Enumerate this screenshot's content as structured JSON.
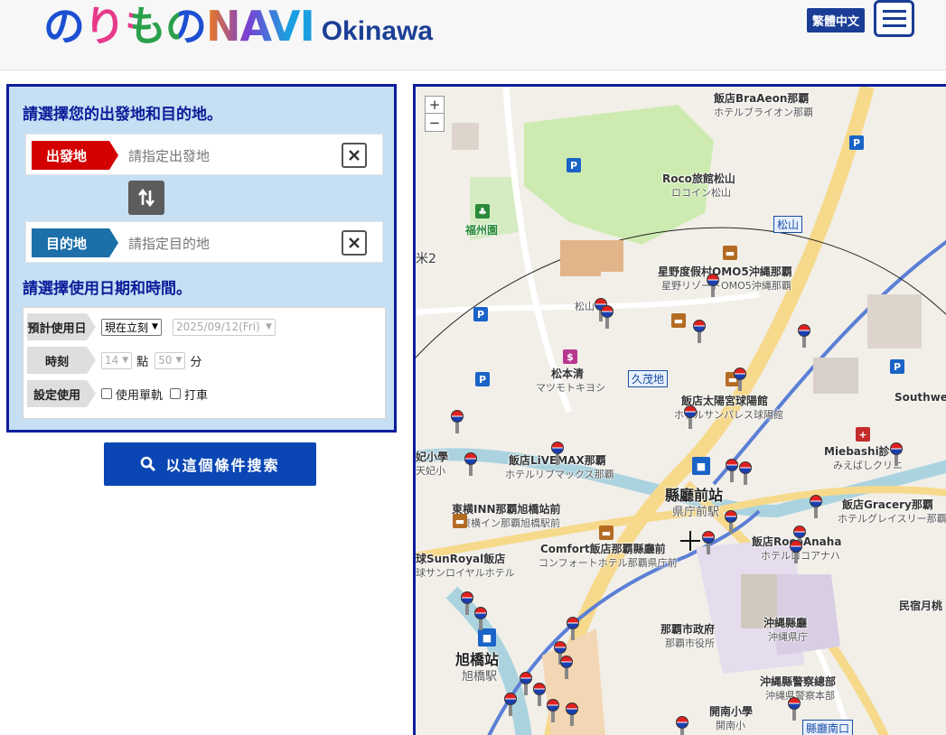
{
  "header": {
    "logo_text": "のりものNAVI",
    "logo_region": "Okinawa",
    "language_label": "繁體中文",
    "menu_icon": "hamburger-menu-icon"
  },
  "search": {
    "title": "請選擇您的出發地和目的地。",
    "origin": {
      "tag": "出發地",
      "placeholder": "請指定出發地"
    },
    "destination": {
      "tag": "目的地",
      "placeholder": "請指定目的地"
    },
    "swap_icon": "swap-arrows-icon",
    "clear_icon": "close-icon",
    "date_title": "請選擇使用日期和時間。",
    "options": {
      "date_label": "預計使用日",
      "date_mode": "現在立刻",
      "date_value": "2025/09/12(Fri)",
      "time_label": "時刻",
      "hour": "14",
      "hour_unit": "點",
      "minute": "50",
      "minute_unit": "分",
      "settings_label": "設定使用",
      "monorail_label": "使用單軌",
      "taxi_label": "打車"
    },
    "submit_label": "以這個條件搜索"
  },
  "map": {
    "zoom_in": "+",
    "zoom_out": "−",
    "labels": {
      "l1": "飯店BraAeon那覇",
      "l1s": "ホテルブライオン那覇",
      "l2": "Roco旅館松山",
      "l2s": "ロコイン松山",
      "l3": "福州園",
      "l4": "松山",
      "l5": "星野度假村OMO5沖縄那覇",
      "l5s": "星野リゾートOMO5沖縄那覇",
      "l6": "松本清",
      "l6s": "マツモトキヨシ",
      "l7": "久茂地",
      "l8": "飯店太陽宮球陽館",
      "l8s": "ホテルサンパレス球陽館",
      "l9": "Southwes",
      "l10": "飯店LiVEMAX那覇",
      "l10s": "ホテルリブマックス那覇",
      "l11": "Miebashi診",
      "l11s": "みえばしクリニ",
      "l12": "縣廳前站",
      "l12s": "県庁前駅",
      "l13": "東横INN那覇旭橋站前",
      "l13s": "東横イン那覇旭橋駅前",
      "l14": "飯店Gracery那覇",
      "l14s": "ホテルグレイスリー那覇",
      "l15": "Comfort飯店那覇縣廳前",
      "l15s": "コンフォートホテル那覇県庁前",
      "l16": "飯店RocoAnaha",
      "l16s": "ホテルロコアナハ",
      "l17": "球SunRoyal飯店",
      "l17s": "球サンロイヤルホテル",
      "l18": "那覇市政府",
      "l18s": "那覇市役所",
      "l19": "沖縄縣廳",
      "l19s": "沖縄県庁",
      "l20": "民宿月桃",
      "l21": "旭橋站",
      "l21s": "旭橋駅",
      "l22": "沖縄縣警察總部",
      "l22s": "沖縄県警察本部",
      "l23": "開南小學",
      "l23s": "開南小",
      "l24": "縣廳南口",
      "l25": "米2",
      "l26": "妃小學",
      "l26s": "天妃小",
      "l27": "松山"
    }
  }
}
